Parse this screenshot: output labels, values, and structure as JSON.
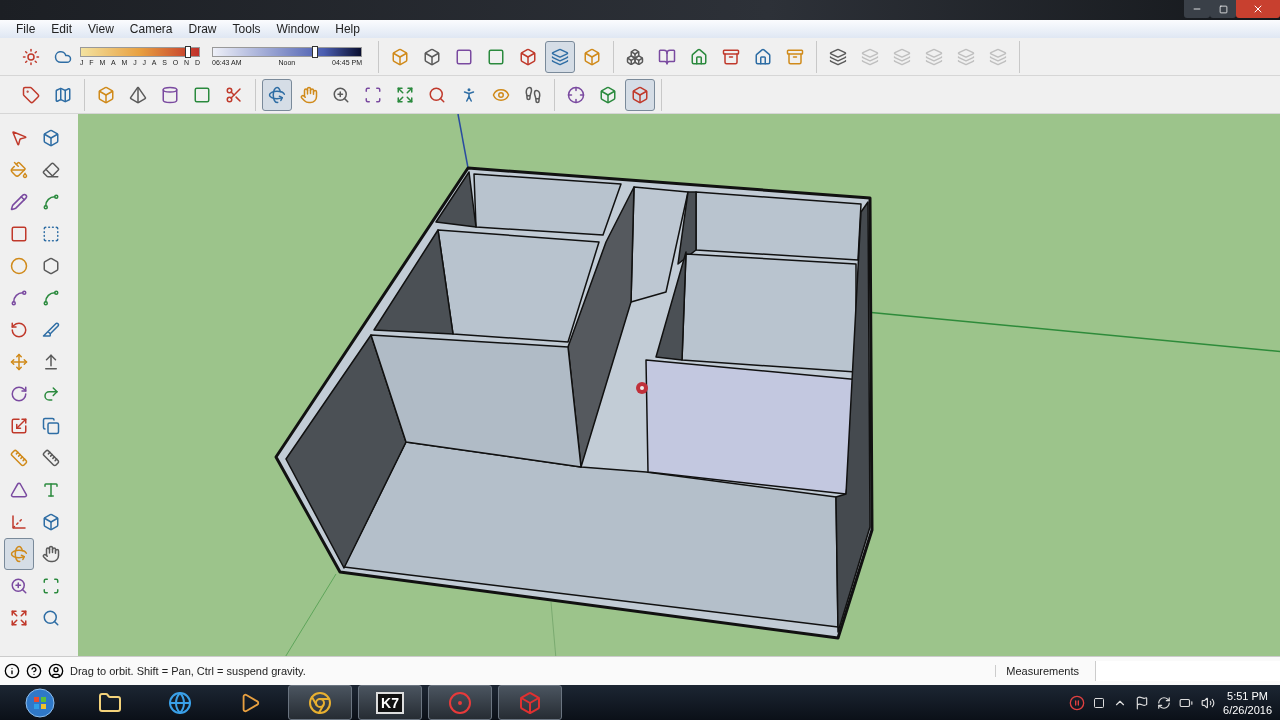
{
  "menu": [
    "File",
    "Edit",
    "View",
    "Camera",
    "Draw",
    "Tools",
    "Window",
    "Help"
  ],
  "toolbar_row_1": {
    "month_slider": {
      "months": "J F M A M J J A S O N D",
      "level": 0.9
    },
    "time_slider": {
      "times": [
        "06:43 AM",
        "Noon",
        "04:45 PM"
      ],
      "level": 0.68
    },
    "buttons": [
      {
        "selected": false,
        "disabled": false
      },
      {
        "selected": false,
        "disabled": false
      },
      {
        "selected": false,
        "disabled": false
      },
      {
        "selected": false,
        "disabled": false
      },
      {
        "selected": false,
        "disabled": false
      },
      {
        "selected": false,
        "disabled": false
      },
      {
        "selected": false,
        "disabled": false
      },
      {
        "selected": true,
        "disabled": false
      },
      {
        "selected": false,
        "disabled": false
      },
      {
        "selected": false,
        "disabled": false
      },
      {
        "selected": false,
        "disabled": false
      },
      {
        "selected": false,
        "disabled": false
      },
      {
        "selected": false,
        "disabled": false
      },
      {
        "selected": false,
        "disabled": false
      },
      {
        "selected": false,
        "disabled": false
      },
      {
        "selected": false,
        "disabled": false
      },
      {
        "selected": false,
        "disabled": true
      },
      {
        "selected": false,
        "disabled": true
      },
      {
        "selected": false,
        "disabled": true
      },
      {
        "selected": false,
        "disabled": true
      },
      {
        "selected": false,
        "disabled": true
      }
    ]
  },
  "toolbar_row_2": [
    {
      "selected": false
    },
    {
      "selected": false
    },
    {
      "selected": false
    },
    {
      "selected": false
    },
    {
      "selected": false
    },
    {
      "selected": false
    },
    {
      "selected": false
    },
    {
      "selected": true
    },
    {
      "selected": false
    },
    {
      "selected": false
    },
    {
      "selected": false
    },
    {
      "selected": false
    },
    {
      "selected": false
    },
    {
      "selected": false
    },
    {
      "selected": false
    },
    {
      "selected": false
    },
    {
      "selected": false
    },
    {
      "selected": false
    },
    {
      "selected": true
    }
  ],
  "tool_palette": [
    {
      "selected": false
    },
    {
      "selected": false
    },
    {
      "selected": false
    },
    {
      "selected": false
    },
    {
      "selected": false
    },
    {
      "selected": false
    },
    {
      "selected": false
    },
    {
      "selected": false
    },
    {
      "selected": false
    },
    {
      "selected": false
    },
    {
      "selected": false
    },
    {
      "selected": false
    },
    {
      "selected": false
    },
    {
      "selected": false
    },
    {
      "selected": false
    },
    {
      "selected": false
    },
    {
      "selected": false
    },
    {
      "selected": false
    },
    {
      "selected": false
    },
    {
      "selected": false
    },
    {
      "selected": false
    },
    {
      "selected": false
    },
    {
      "selected": false
    },
    {
      "selected": false
    },
    {
      "selected": false
    },
    {
      "selected": false
    },
    {
      "selected": true
    },
    {
      "selected": false
    },
    {
      "selected": false
    },
    {
      "selected": false
    },
    {
      "selected": false
    },
    {
      "selected": false
    }
  ],
  "status_bar": {
    "hint": "Drag to orbit. Shift = Pan, Ctrl = suspend gravity.",
    "measurements_label": "Measurements"
  },
  "taskbar": {
    "app_label": "K7",
    "clock_time": "5:51 PM",
    "clock_date": "6/26/2016"
  }
}
